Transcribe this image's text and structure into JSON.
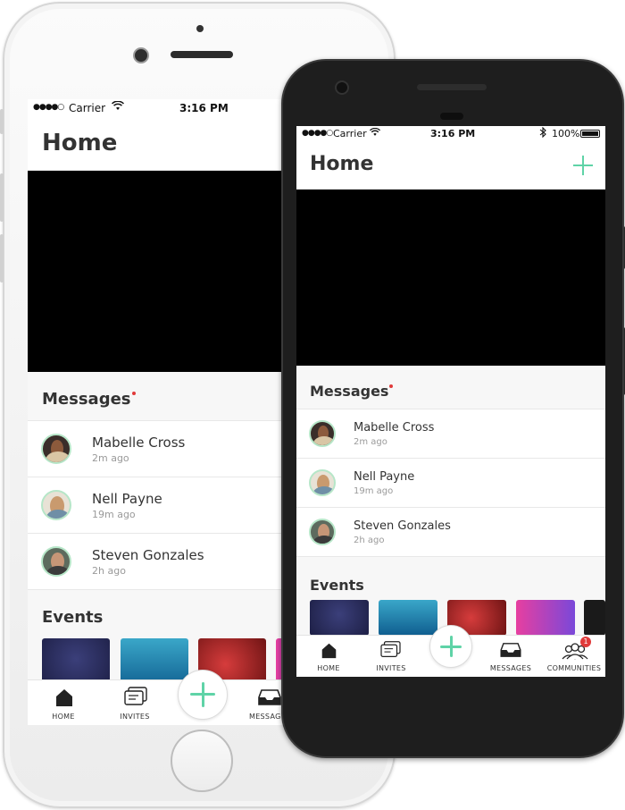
{
  "status_bar": {
    "signal": "●●●●○",
    "carrier": "Carrier",
    "time": "3:16 PM",
    "battery_text": "100%"
  },
  "header": {
    "title": "Home"
  },
  "messages": {
    "title": "Messages",
    "items": [
      {
        "name": "Mabelle Cross",
        "time": "2m ago"
      },
      {
        "name": "Nell Payne",
        "time": "19m ago"
      },
      {
        "name": "Steven Gonzales",
        "time": "2h ago"
      }
    ]
  },
  "events": {
    "title": "Events"
  },
  "tabbar": {
    "home": "HOME",
    "invites": "INVITES",
    "messages": "MESSAGES",
    "messages_truncated": "MESSAG",
    "communities": "COMMUNITIES",
    "communities_badge": "1"
  },
  "colors": {
    "accent": "#5fd3a7",
    "badge": "#e03a3a"
  },
  "icons": {
    "add": "plus-icon",
    "home": "home-icon",
    "invites": "invites-icon",
    "messages": "inbox-icon",
    "communities": "people-icon"
  }
}
